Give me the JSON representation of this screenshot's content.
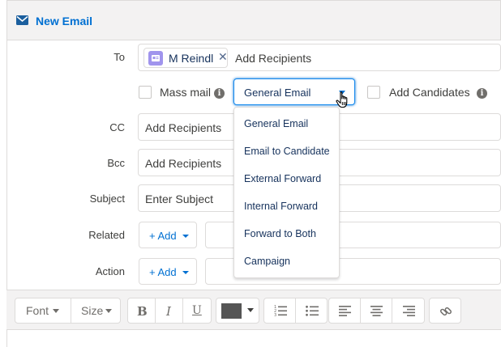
{
  "header": {
    "title": "New Email",
    "icon": "envelope-icon"
  },
  "to": {
    "label": "To",
    "recipient": "M Reindl",
    "remove": "✕",
    "placeholder": "Add Recipients"
  },
  "options": {
    "mass_mail_label": "Mass mail",
    "template_selected": "General Email",
    "add_candidates_label": "Add Candidates",
    "info_glyph": "i"
  },
  "dropdown": {
    "options": [
      "General Email",
      "Email to Candidate",
      "External Forward",
      "Internal Forward",
      "Forward to Both",
      "Campaign"
    ]
  },
  "cc": {
    "label": "CC",
    "placeholder": "Add Recipients"
  },
  "bcc": {
    "label": "Bcc",
    "placeholder": "Add Recipients"
  },
  "subject": {
    "label": "Subject",
    "placeholder": "Enter Subject"
  },
  "related": {
    "label": "Related",
    "button": "+ Add"
  },
  "action": {
    "label": "Action",
    "button": "+ Add"
  },
  "toolbar": {
    "font": "Font",
    "size": "Size",
    "bold": "B",
    "italic": "I",
    "underline": "U",
    "text_color": "#555555",
    "icons": [
      "bold-icon",
      "italic-icon",
      "underline-icon",
      "text-color-icon",
      "numbered-list-icon",
      "bulleted-list-icon",
      "align-left-icon",
      "align-center-icon",
      "align-right-icon",
      "link-icon"
    ]
  },
  "colors": {
    "accent": "#0070d2",
    "text": "#16325c",
    "border": "#dddbda",
    "header_bg": "#f3f2f2"
  }
}
